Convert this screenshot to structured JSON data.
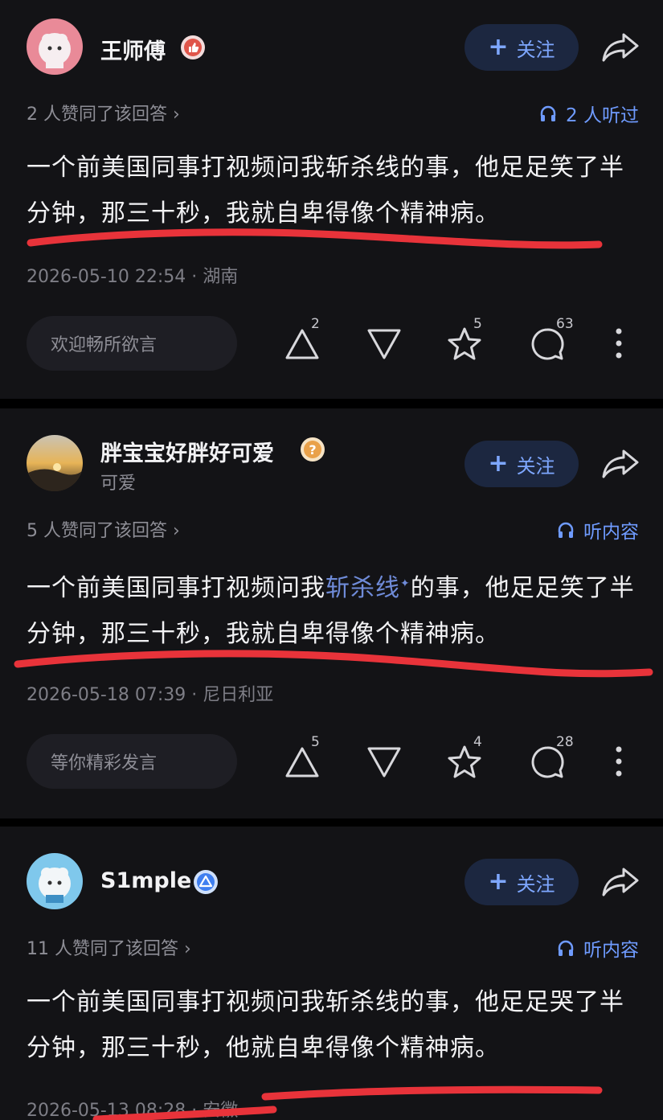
{
  "posts": [
    {
      "username": "王师傅",
      "badge_icon": "thumbs-up-badge",
      "follow_label": "关注",
      "agree_text": "2 人赞同了该回答 ›",
      "listen_text": "2 人听过",
      "content_pre": "一个前美国同事打视频问我斩杀线的事，他足足笑了半分钟，那三十秒，我就自卑得像个精神病。",
      "timestamp_location": "2026-05-10 22:54 · 湖南",
      "comment_placeholder": "欢迎畅所欲言",
      "upvotes": "2",
      "stars": "5",
      "comments": "63"
    },
    {
      "username": "胖宝宝好胖好可爱",
      "subtitle": "可爱",
      "badge_icon": "question-badge",
      "follow_label": "关注",
      "agree_text": "5 人赞同了该回答 ›",
      "listen_text": "听内容",
      "content_pre": "一个前美国同事打视频问我",
      "content_link": "斩杀线",
      "content_post": "的事，他足足笑了半分钟，那三十秒，我就自卑得像个精神病。",
      "timestamp_location": "2026-05-18 07:39 · 尼日利亚",
      "comment_placeholder": "等你精彩发言",
      "upvotes": "5",
      "stars": "4",
      "comments": "28"
    },
    {
      "username": "S1mple",
      "badge_icon": "blue-triangle-badge",
      "follow_label": "关注",
      "agree_text": "11 人赞同了该回答 ›",
      "listen_text": "听内容",
      "content_pre": "一个前美国同事打视频问我斩杀线的事，他足足哭了半分钟，那三十秒，他就自卑得像个精神病。",
      "timestamp_location": "2026-05-13 08:28 · 安徽"
    }
  ],
  "colors": {
    "background": "#131316",
    "accent_blue": "#6f9bff",
    "follow_bg": "#1c2740",
    "underline_red": "#e8333a"
  }
}
